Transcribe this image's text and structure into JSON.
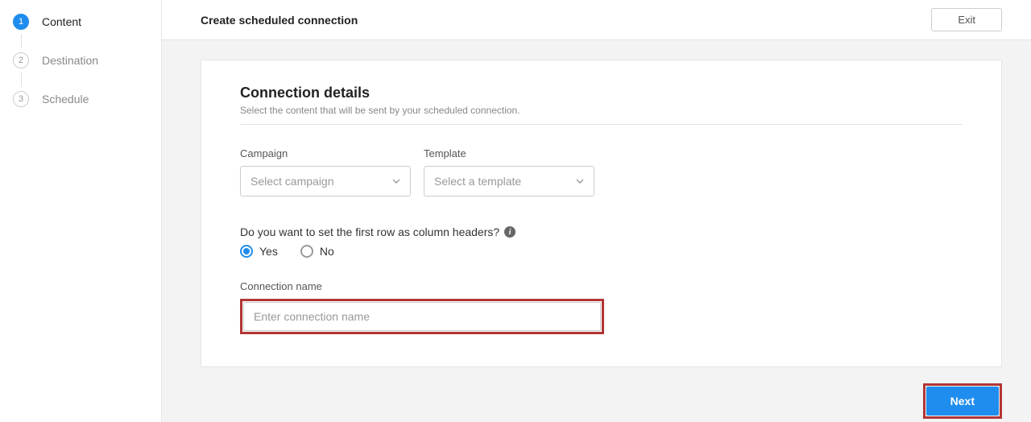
{
  "header": {
    "title": "Create scheduled connection",
    "exit": "Exit"
  },
  "steps": [
    {
      "num": "1",
      "label": "Content",
      "active": true
    },
    {
      "num": "2",
      "label": "Destination",
      "active": false
    },
    {
      "num": "3",
      "label": "Schedule",
      "active": false
    }
  ],
  "section": {
    "title": "Connection details",
    "subtitle": "Select the content that will be sent by your scheduled connection."
  },
  "campaign": {
    "label": "Campaign",
    "placeholder": "Select campaign"
  },
  "template": {
    "label": "Template",
    "placeholder": "Select a template"
  },
  "headerRow": {
    "question": "Do you want to set the first row as column headers?",
    "yes": "Yes",
    "no": "No"
  },
  "connName": {
    "label": "Connection name",
    "placeholder": "Enter connection name"
  },
  "footer": {
    "next": "Next"
  }
}
